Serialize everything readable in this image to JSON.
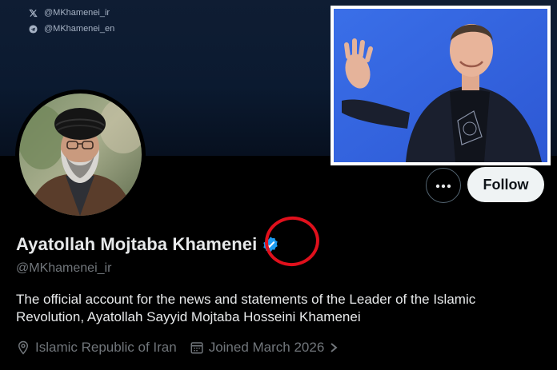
{
  "banner": {
    "handles": [
      {
        "icon": "x-logo-icon",
        "text": "@MKhamenei_ir"
      },
      {
        "icon": "telegram-icon",
        "text": "@MKhamenei_en"
      }
    ]
  },
  "profile": {
    "name": "Ayatollah Mojtaba Khamenei",
    "handle": "@MKhamenei_ir",
    "bio": "The official account for the news and statements of the Leader of the Islamic Revolution, Ayatollah Sayyid Mojtaba Hosseini Khamenei",
    "location": "Islamic Republic of Iran",
    "joined": "Joined March 2026"
  },
  "actions": {
    "follow_label": "Follow",
    "more_icon": "more-icon"
  },
  "colors": {
    "verified": "#1d9bf0",
    "annotation_circle": "#e0101c",
    "follow_bg": "#eff3f4",
    "secondary_text": "#71767b"
  }
}
